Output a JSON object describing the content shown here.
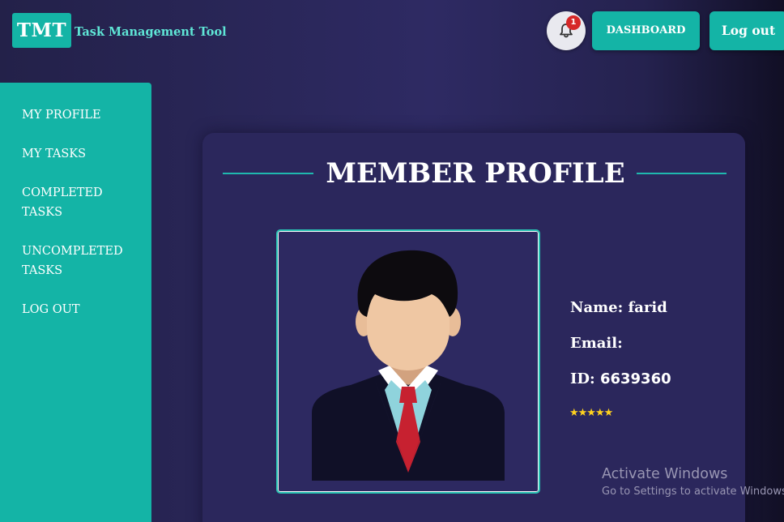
{
  "header": {
    "logo_text": "TMT",
    "app_name": "Task Management Tool",
    "notification_count": "1",
    "dashboard_label": "DASHBOARD",
    "logout_label": "Log out"
  },
  "sidebar": {
    "items": [
      {
        "label": "MY PROFILE"
      },
      {
        "label": "MY TASKS"
      },
      {
        "label": "COMPLETED TASKS"
      },
      {
        "label": "UNCOMPLETED TASKS"
      },
      {
        "label": "LOG OUT"
      }
    ]
  },
  "profile": {
    "title": "MEMBER PROFILE",
    "name_label": "Name: ",
    "name_value": "farid",
    "email_label": "Email:",
    "id_label": "ID: ",
    "id_value": "6639360",
    "rating_stars": "★★★★★"
  },
  "windows_watermark": {
    "title": "Activate Windows",
    "subtitle": "Go to Settings to activate Windows."
  },
  "colors": {
    "accent": "#14b4a6",
    "background": "#2e2a63",
    "badge": "#d62828",
    "stars": "#ffd21f"
  },
  "icons": {
    "notifications": "bell-icon",
    "avatar": "user-avatar-illustration"
  }
}
